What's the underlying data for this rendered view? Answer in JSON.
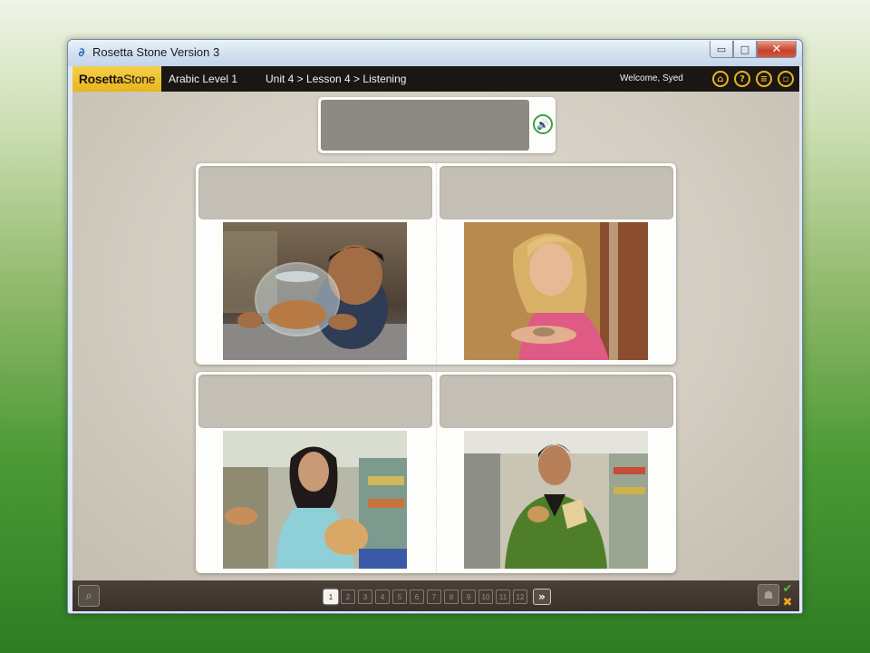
{
  "window": {
    "title": "Rosetta Stone Version 3",
    "minimize_label": "▭",
    "maximize_label": "□",
    "close_label": "✕"
  },
  "header": {
    "logo_rosetta": "Rosetta",
    "logo_stone": "Stone",
    "course": "Arabic Level 1",
    "breadcrumb": "Unit 4 > Lesson 4 > Listening",
    "welcome": "Welcome, Syed",
    "icons": [
      "home-icon",
      "help-icon",
      "menu-icon",
      "window-icon"
    ]
  },
  "prompt": {
    "speaker_icon": "speaker-icon"
  },
  "cards": [
    {
      "id": "boy-coin-jar",
      "photo": "boy with jar of coins"
    },
    {
      "id": "woman-coins-hand",
      "photo": "woman holding coins"
    },
    {
      "id": "woman-bread-store",
      "photo": "woman holding bread in store"
    },
    {
      "id": "man-bread-store",
      "photo": "man holding bread in store"
    }
  ],
  "footer": {
    "pages": [
      "1",
      "2",
      "3",
      "4",
      "5",
      "6",
      "7",
      "8",
      "9",
      "10",
      "11",
      "12"
    ],
    "active_page": "1",
    "next_label": "»",
    "check_label": "✔",
    "x_label": "✖"
  },
  "colors": {
    "accent": "#e8b51e",
    "header_bg": "#1a1614",
    "speaker_green": "#37a43a",
    "answer_slot": "#c4bfb5"
  }
}
